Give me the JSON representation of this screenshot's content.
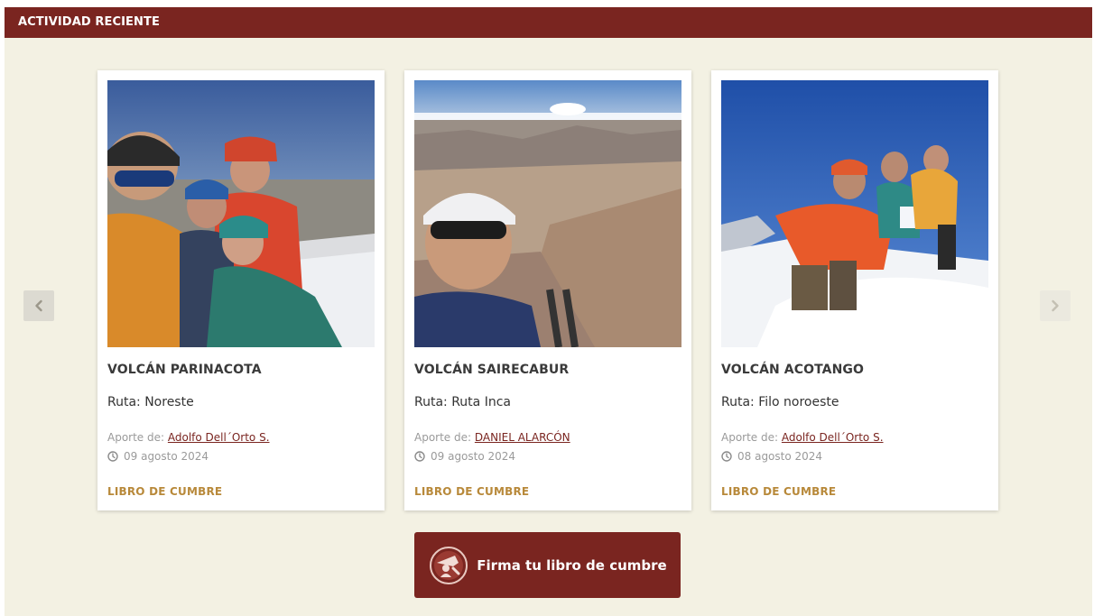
{
  "section": {
    "title": "ACTIVIDAD RECIENTE"
  },
  "carousel": {
    "prev_icon": "chevron-left-icon",
    "next_icon": "chevron-right-icon",
    "cards": [
      {
        "title": "VOLCÁN PARINACOTA",
        "route": "Ruta: Noreste",
        "contrib_prefix": "Aporte de:",
        "contributor": "Adolfo Dell´Orto S.",
        "date": "09 agosto 2024",
        "link_label": "LIBRO DE CUMBRE"
      },
      {
        "title": "VOLCÁN SAIRECABUR",
        "route": "Ruta: Ruta Inca",
        "contrib_prefix": "Aporte de:",
        "contributor": "DANIEL ALARCÓN",
        "date": "09 agosto 2024",
        "link_label": "LIBRO DE CUMBRE"
      },
      {
        "title": "VOLCÁN ACOTANGO",
        "route": "Ruta: Filo noroeste",
        "contrib_prefix": "Aporte de:",
        "contributor": "Adolfo Dell´Orto S.",
        "date": "08 agosto 2024",
        "link_label": "LIBRO DE CUMBRE"
      }
    ]
  },
  "cta": {
    "label": "Firma tu libro de cumbre",
    "icon": "summit-book-icon"
  },
  "colors": {
    "brand": "#7a2520",
    "background": "#f3f1e3",
    "link_accent": "#b8893a"
  }
}
